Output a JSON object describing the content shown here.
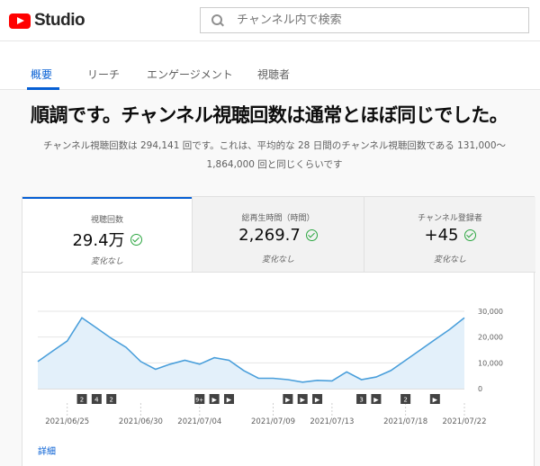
{
  "header": {
    "brand": "Studio",
    "search_placeholder": "チャンネル内で検索"
  },
  "tabs": [
    "概要",
    "リーチ",
    "エンゲージメント",
    "視聴者"
  ],
  "active_tab": 0,
  "headline": "順調です。チャンネル視聴回数は通常とほぼ同じでした。",
  "description": "チャンネル視聴回数は 294,141 回です。これは、平均的な 28 日間のチャンネル視聴回数である 131,000～ 1,864,000 回と同じくらいです",
  "metrics": [
    {
      "label": "視聴回数",
      "value": "29.4万",
      "sub": "変化なし"
    },
    {
      "label": "総再生時間（時間）",
      "value": "2,269.7",
      "sub": "変化なし"
    },
    {
      "label": "チャンネル登録者",
      "value": "+45",
      "sub": "変化なし"
    }
  ],
  "more_link": "詳細",
  "colors": {
    "accent": "#065fd4",
    "line": "#4a9fdb",
    "fill": "#e3f0fa",
    "check": "#2ba640"
  },
  "chart_data": {
    "type": "area",
    "x": [
      "2021/06/23",
      "2021/06/24",
      "2021/06/25",
      "2021/06/26",
      "2021/06/27",
      "2021/06/28",
      "2021/06/29",
      "2021/06/30",
      "2021/07/01",
      "2021/07/02",
      "2021/07/03",
      "2021/07/04",
      "2021/07/05",
      "2021/07/06",
      "2021/07/07",
      "2021/07/08",
      "2021/07/09",
      "2021/07/10",
      "2021/07/11",
      "2021/07/12",
      "2021/07/13",
      "2021/07/14",
      "2021/07/15",
      "2021/07/16",
      "2021/07/17",
      "2021/07/18",
      "2021/07/19",
      "2021/07/20",
      "2021/07/21",
      "2021/07/22"
    ],
    "series": [
      {
        "values": [
          10500,
          14500,
          18500,
          27500,
          23500,
          19500,
          16000,
          10500,
          7500,
          9500,
          11000,
          9500,
          12000,
          11000,
          7000,
          4000,
          4000,
          3500,
          2500,
          3200,
          3000,
          6500,
          3500,
          4500,
          7000,
          11000,
          15000,
          19000,
          23000,
          27500
        ]
      }
    ],
    "x_tick_labels": [
      "2021/06/25",
      "2021/06/30",
      "2021/07/04",
      "2021/07/09",
      "2021/07/13",
      "2021/07/18",
      "2021/07/22"
    ],
    "x_tick_index": [
      2,
      7,
      11,
      16,
      20,
      25,
      29
    ],
    "y_ticks": [
      "0",
      "10,000",
      "20,000",
      "30,000"
    ],
    "ylim": [
      0,
      30000
    ],
    "grid": true,
    "markers": [
      {
        "index": 3,
        "text": "2"
      },
      {
        "index": 4,
        "text": "4"
      },
      {
        "index": 5,
        "text": "2"
      },
      {
        "index": 11,
        "text": "9+"
      },
      {
        "index": 12,
        "text": "▶"
      },
      {
        "index": 13,
        "text": "▶"
      },
      {
        "index": 17,
        "text": "▶"
      },
      {
        "index": 18,
        "text": "▶"
      },
      {
        "index": 19,
        "text": "▶"
      },
      {
        "index": 22,
        "text": "3"
      },
      {
        "index": 23,
        "text": "▶"
      },
      {
        "index": 25,
        "text": "2"
      },
      {
        "index": 27,
        "text": "▶"
      }
    ]
  }
}
